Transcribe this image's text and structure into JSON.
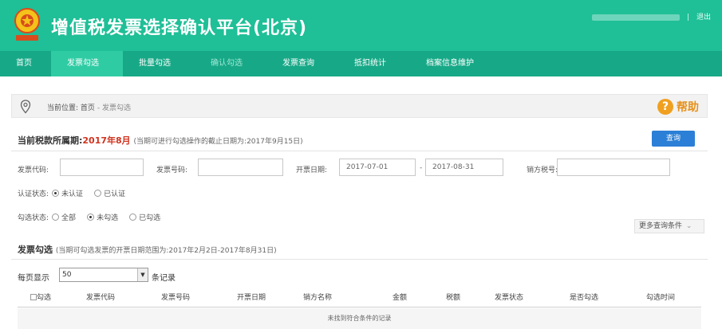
{
  "app": {
    "title": "增值税发票选择确认平台(北京)",
    "logout_label": "退出",
    "user_separator": "|"
  },
  "nav": {
    "items": [
      {
        "label": "首页"
      },
      {
        "label": "发票勾选"
      },
      {
        "label": "批量勾选"
      },
      {
        "label": "确认勾选"
      },
      {
        "label": "发票查询"
      },
      {
        "label": "抵扣统计"
      },
      {
        "label": "档案信息维护"
      }
    ],
    "active_index": 1
  },
  "breadcrumb": {
    "prefix": "当前位置:",
    "home": "首页",
    "separator": "-",
    "current": "发票勾选"
  },
  "help": {
    "label": "帮助",
    "icon": "question-icon"
  },
  "period": {
    "label": "当前税款所属期:",
    "value": "2017年8月",
    "note": "(当期可进行勾选操作的截止日期为:2017年9月15日)"
  },
  "query_button": "查询",
  "filters": {
    "invoice_code_label": "发票代码:",
    "invoice_code_value": "",
    "invoice_number_label": "发票号码:",
    "invoice_number_value": "",
    "date_label": "开票日期:",
    "date_start": "2017-07-01",
    "date_separator": "-",
    "date_end": "2017-08-31",
    "seller_tax_label": "销方税号:",
    "seller_tax_value": "",
    "cert_status": {
      "label": "认证状态:",
      "options": [
        "未认证",
        "已认证"
      ],
      "selected": "未认证"
    },
    "select_status": {
      "label": "勾选状态:",
      "options": [
        "全部",
        "未勾选",
        "已勾选"
      ],
      "selected": "未勾选"
    },
    "more_label": "更多查询条件"
  },
  "invoice_section": {
    "title": "发票勾选",
    "note": "(当期可勾选发票的开票日期范围为:2017年2月2日-2017年8月31日)",
    "page_size_label": "每页显示",
    "page_size_value": "50",
    "records_label": "条记录",
    "columns": [
      "勾选",
      "发票代码",
      "发票号码",
      "开票日期",
      "销方名称",
      "金额",
      "税额",
      "发票状态",
      "是否勾选",
      "勾选时间"
    ],
    "empty_message": "未找到符合条件的记录"
  },
  "colors": {
    "header": "#1fbf97",
    "nav": "#17a987",
    "nav_active": "#2fcca4",
    "period_value": "#d0341f",
    "query_button": "#2b7fd6",
    "help": "#f0a020"
  }
}
